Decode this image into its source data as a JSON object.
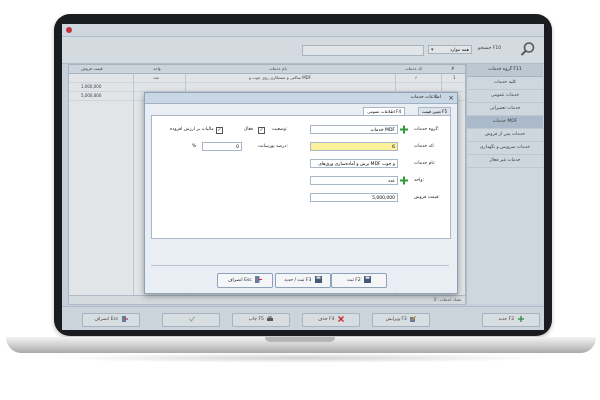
{
  "toolbar": {
    "group_label": "جستجو F10",
    "select_value": "همه موارد"
  },
  "grid": {
    "headers": [
      "قیمت فروش",
      "واحد",
      "نام خدمات",
      "کد خدمات",
      "#"
    ],
    "rows": [
      {
        "price": "",
        "unit": "عدد",
        "name": "ساکتی و مستکاری روی چوب و MDF",
        "code": "۶",
        "idx": "1"
      },
      {
        "price": "1,000,000",
        "unit": "",
        "name": "",
        "code": "",
        "idx": ""
      },
      {
        "price": "5,000,000",
        "unit": "",
        "name": "",
        "code": "",
        "idx": ""
      }
    ],
    "footer": "تعداد خدمات : 3"
  },
  "sidebar": {
    "header": "گروه خدمات F11",
    "items": [
      {
        "label": "کلیه خدمات",
        "active": false
      },
      {
        "label": "خدمات عمومی",
        "active": false
      },
      {
        "label": "خدمات تعمیراتی",
        "active": false
      },
      {
        "label": "خدمات MDF",
        "active": true
      },
      {
        "label": "خدمات پس از فروش",
        "active": false
      },
      {
        "label": "خدمات سرویس و نگهداری",
        "active": false
      },
      {
        "label": "خدمات غیر فعال",
        "active": false
      }
    ]
  },
  "bottom": {
    "new": "جدید F2",
    "edit": "ویرایش F3",
    "delete": "حذف F4",
    "print": "چاپ F5",
    "disabled": "",
    "cancel": "انصراف Esc"
  },
  "dialog": {
    "title": "اطلاعات خدمات",
    "tab_general": "اطلاعات عمومی F4",
    "tab_price": "تعیین قیمت F5",
    "group_label": "گروه خدمات:",
    "group_value": "خدمات MDF",
    "status_label": "وضعیت:",
    "status_value": "فعال",
    "vat_label": "مالیات بر ارزش افزوده",
    "code_label": "کد خدمات:",
    "code_value": "6",
    "percent_label": "درصد پورسانت:",
    "percent_value": "0",
    "percent_sign": "%",
    "name_label": "نام خدمات:",
    "name_value": "برش و آماده‌سازی ورق‌های MDF و چوب",
    "unit_label": "واحد:",
    "unit_value": "عدد",
    "price_label": "قیمت فروش:",
    "price_value": "5,000,000",
    "btn_save": "ثبت F2",
    "btn_save_new": "ثبت / جدید F3",
    "btn_cancel": "انصراف Esc"
  }
}
